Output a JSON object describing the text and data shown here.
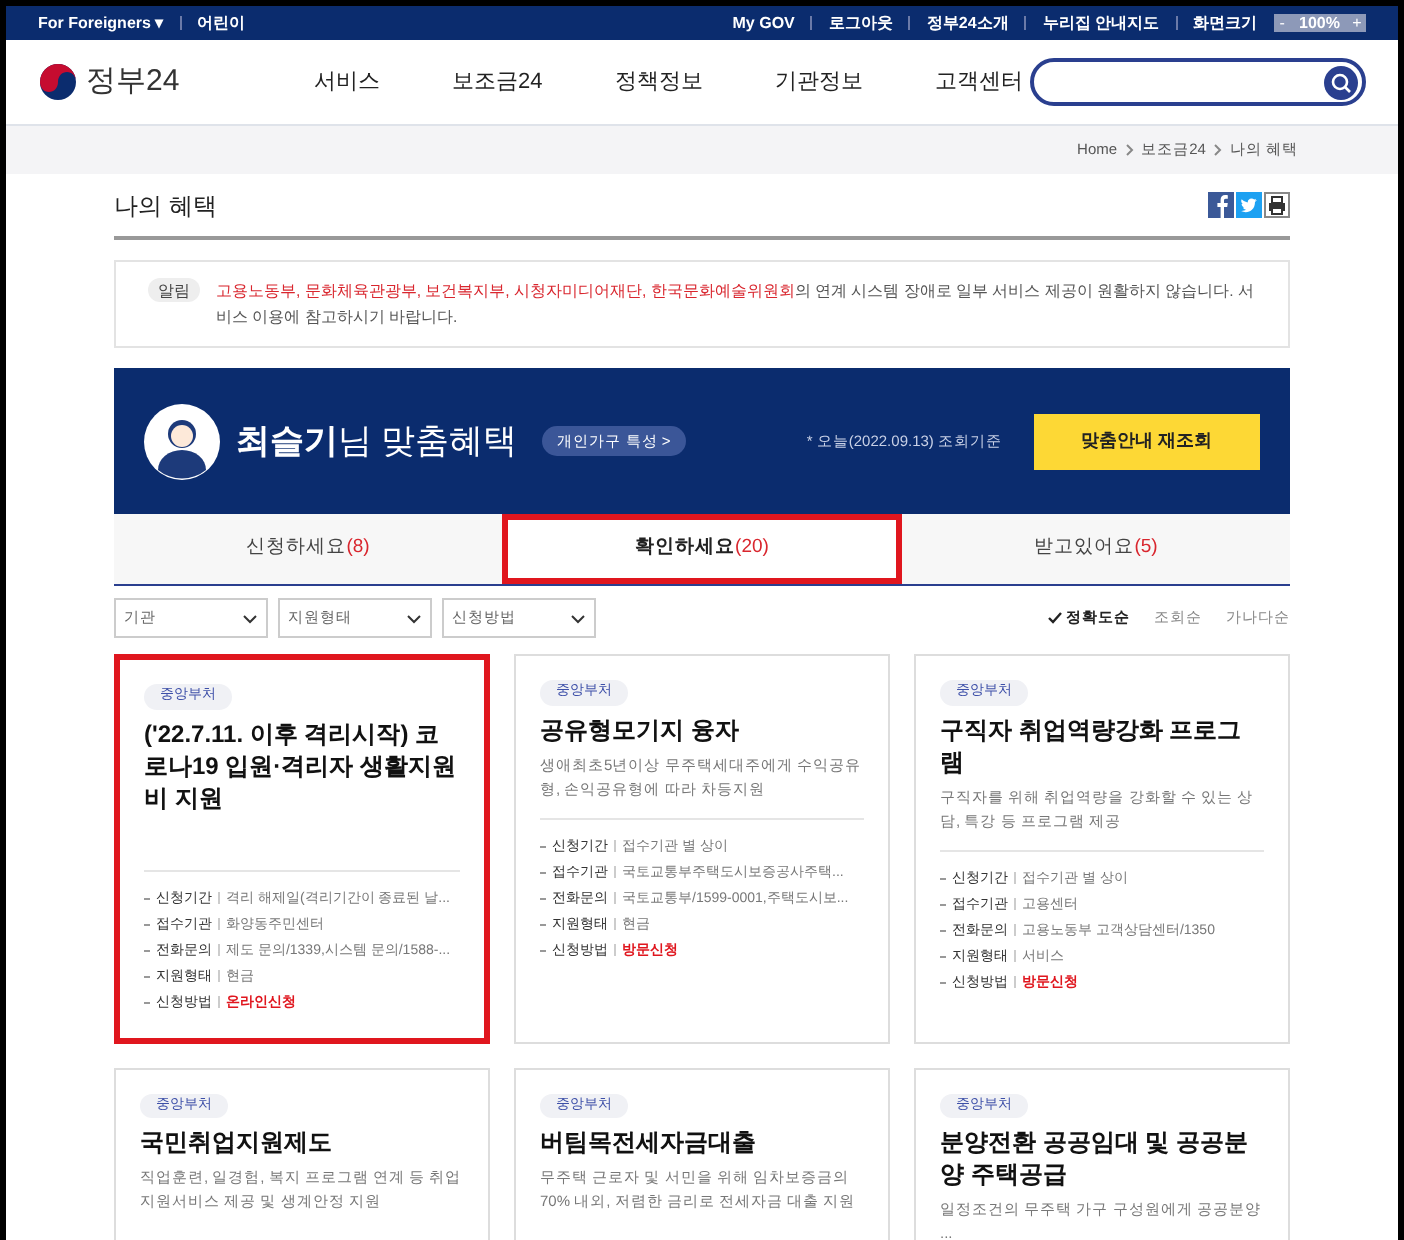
{
  "top_bar": {
    "left": [
      {
        "label": "For Foreigners ▾"
      },
      {
        "label": "어린이"
      }
    ],
    "right": [
      {
        "label": "My GOV"
      },
      {
        "label": "로그아웃"
      },
      {
        "label": "정부24소개"
      },
      {
        "label": "누리집 안내지도"
      }
    ],
    "zoom": {
      "label": "화면크기",
      "minus": "-",
      "value": "100%",
      "plus": "+"
    }
  },
  "header": {
    "logo": "정부24",
    "nav": [
      {
        "label": "서비스"
      },
      {
        "label": "보조금24"
      },
      {
        "label": "정책정보"
      },
      {
        "label": "기관정보"
      },
      {
        "label": "고객센터"
      }
    ]
  },
  "breadcrumb": [
    {
      "label": "Home"
    },
    {
      "label": "보조금24"
    },
    {
      "label": "나의 혜택"
    }
  ],
  "page_title": "나의 혜택",
  "notice": {
    "tag": "알림",
    "text": "고용노동부, 문화체육관광부, 보건복지부, 시청자미디어재단, 한국문화예술위원회",
    "rest": "의 연계 시스템 장애로 일부 서비스 제공이 원활하지 않습니다. 서비스 이용에 참고하시기 바랍니다."
  },
  "banner": {
    "name": "최슬기",
    "suffix": "님 맞춤혜택",
    "badge": "개인가구 특성 >",
    "date_note": "* 오늘(2022.09.13) 조회기준",
    "button": "맞춤안내 재조회"
  },
  "tabs": [
    {
      "label": "신청하세요",
      "count": "(8)",
      "selected": false,
      "highlighted": false
    },
    {
      "label": "확인하세요",
      "count": "(20)",
      "selected": true,
      "highlighted": true
    },
    {
      "label": "받고있어요",
      "count": "(5)",
      "selected": false,
      "highlighted": false
    }
  ],
  "filters": [
    {
      "label": "기관"
    },
    {
      "label": "지원형태"
    },
    {
      "label": "신청방법"
    }
  ],
  "sort": [
    {
      "label": "정확도순",
      "selected": true
    },
    {
      "label": "조회순",
      "selected": false
    },
    {
      "label": "가나다순",
      "selected": false
    }
  ],
  "cards": [
    {
      "tag": "중앙부처",
      "title": "('22.7.11. 이후 격리시작) 코로나19 입원·격리자 생활지원비 지원",
      "highlighted": true,
      "fields": [
        {
          "label": "신청기간",
          "value": "격리 해제일(격리기간이 종료된 날..."
        },
        {
          "label": "접수기관",
          "value": "화양동주민센터"
        },
        {
          "label": "전화문의",
          "value": "제도 문의/1339,시스템 문의/1588-..."
        },
        {
          "label": "지원형태",
          "value": "현금"
        },
        {
          "label": "신청방법",
          "value": "온라인신청",
          "kind": "method"
        }
      ]
    },
    {
      "tag": "중앙부처",
      "title": "공유형모기지 융자",
      "description": "생애최초5년이상 무주택세대주에게 수익공유형, 손익공유형에 따라 차등지원",
      "highlighted": false,
      "fields": [
        {
          "label": "신청기간",
          "value": "접수기관 별 상이"
        },
        {
          "label": "접수기관",
          "value": "국토교통부주택도시보증공사주택..."
        },
        {
          "label": "전화문의",
          "value": "국토교통부/1599-0001,주택도시보..."
        },
        {
          "label": "지원형태",
          "value": "현금"
        },
        {
          "label": "신청방법",
          "value": "방문신청",
          "kind": "method"
        }
      ]
    },
    {
      "tag": "중앙부처",
      "title": "구직자 취업역량강화 프로그램",
      "description": "구직자를 위해 취업역량을 강화할 수 있는 상담, 특강 등 프로그램 제공",
      "highlighted": false,
      "fields": [
        {
          "label": "신청기간",
          "value": "접수기관 별 상이"
        },
        {
          "label": "접수기관",
          "value": "고용센터"
        },
        {
          "label": "전화문의",
          "value": "고용노동부 고객상담센터/1350"
        },
        {
          "label": "지원형태",
          "value": "서비스"
        },
        {
          "label": "신청방법",
          "value": "방문신청",
          "kind": "method"
        }
      ]
    },
    {
      "tag": "중앙부처",
      "title": "국민취업지원제도",
      "description": "직업훈련, 일경험, 복지 프로그램 연계 등 취업지원서비스 제공 및 생계안정 지원",
      "highlighted": false
    },
    {
      "tag": "중앙부처",
      "title": "버팀목전세자금대출",
      "description": "무주택 근로자 및 서민을 위해 임차보증금의 70% 내외, 저렴한 금리로 전세자금 대출 지원",
      "highlighted": false
    },
    {
      "tag": "중앙부처",
      "title": "분양전환 공공임대 및 공공분양 주택공급",
      "description": "일정조건의 무주택 가구 구성원에게 공공분양 ...",
      "highlighted": false
    }
  ]
}
